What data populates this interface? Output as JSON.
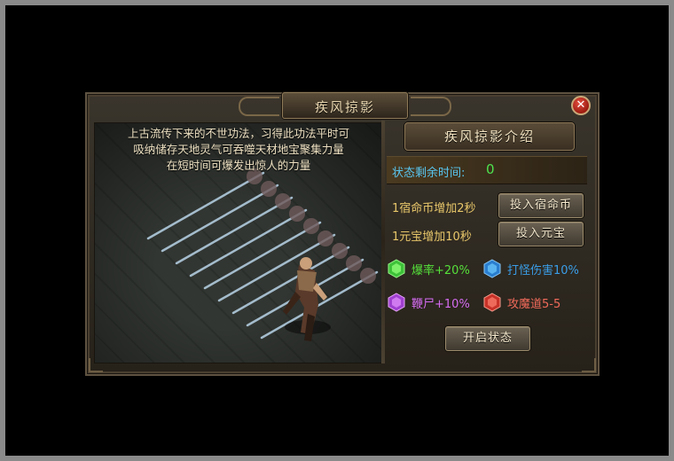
{
  "window": {
    "title": "疾风掠影",
    "close_label": "✕"
  },
  "description": {
    "lines": [
      "上古流传下来的不世功法，习得此功法平时可",
      "吸纳储存天地灵气可吞噬天材地宝聚集力量",
      "在短时间可爆发出惊人的力量"
    ]
  },
  "info": {
    "subtitle": "疾风掠影介绍",
    "timer_label": "状态剩余时间:",
    "timer_value": "0",
    "coin_text": "1宿命币增加2秒",
    "coin_button": "投入宿命币",
    "gold_text": "1元宝增加10秒",
    "gold_button": "投入元宝",
    "activate_button": "开启状态"
  },
  "stats": [
    {
      "name": "爆率",
      "value": "+20%",
      "gem": "green-gem-icon",
      "color": "#55e03a",
      "value_color": "#55e03a"
    },
    {
      "name": "打怪伤害",
      "value": "10%",
      "gem": "blue-gem-icon",
      "color": "#3a9ee8",
      "value_color": "#3a9ee8"
    },
    {
      "name": "鞭尸",
      "value": "+10%",
      "gem": "purple-gem-icon",
      "color": "#d66cf2",
      "value_color": "#d66cf2"
    },
    {
      "name": "攻魔道",
      "value": "5-5",
      "gem": "red-gem-icon",
      "color": "#f06a5a",
      "value_color": "#f06a5a"
    }
  ],
  "colors": {
    "label_blue": "#59c6f0",
    "timer_green": "#4ee24e",
    "text_gold": "#e8c76a"
  }
}
